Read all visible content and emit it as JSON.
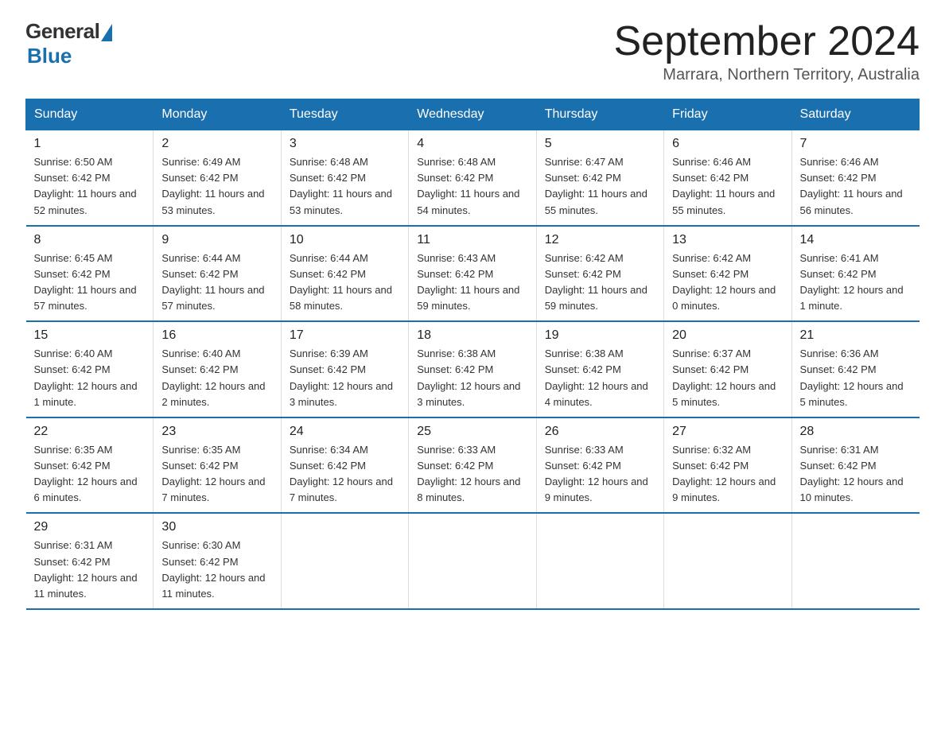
{
  "header": {
    "logo_general": "General",
    "logo_blue": "Blue",
    "title": "September 2024",
    "location": "Marrara, Northern Territory, Australia"
  },
  "columns": [
    "Sunday",
    "Monday",
    "Tuesday",
    "Wednesday",
    "Thursday",
    "Friday",
    "Saturday"
  ],
  "weeks": [
    [
      {
        "day": "1",
        "sunrise": "Sunrise: 6:50 AM",
        "sunset": "Sunset: 6:42 PM",
        "daylight": "Daylight: 11 hours and 52 minutes."
      },
      {
        "day": "2",
        "sunrise": "Sunrise: 6:49 AM",
        "sunset": "Sunset: 6:42 PM",
        "daylight": "Daylight: 11 hours and 53 minutes."
      },
      {
        "day": "3",
        "sunrise": "Sunrise: 6:48 AM",
        "sunset": "Sunset: 6:42 PM",
        "daylight": "Daylight: 11 hours and 53 minutes."
      },
      {
        "day": "4",
        "sunrise": "Sunrise: 6:48 AM",
        "sunset": "Sunset: 6:42 PM",
        "daylight": "Daylight: 11 hours and 54 minutes."
      },
      {
        "day": "5",
        "sunrise": "Sunrise: 6:47 AM",
        "sunset": "Sunset: 6:42 PM",
        "daylight": "Daylight: 11 hours and 55 minutes."
      },
      {
        "day": "6",
        "sunrise": "Sunrise: 6:46 AM",
        "sunset": "Sunset: 6:42 PM",
        "daylight": "Daylight: 11 hours and 55 minutes."
      },
      {
        "day": "7",
        "sunrise": "Sunrise: 6:46 AM",
        "sunset": "Sunset: 6:42 PM",
        "daylight": "Daylight: 11 hours and 56 minutes."
      }
    ],
    [
      {
        "day": "8",
        "sunrise": "Sunrise: 6:45 AM",
        "sunset": "Sunset: 6:42 PM",
        "daylight": "Daylight: 11 hours and 57 minutes."
      },
      {
        "day": "9",
        "sunrise": "Sunrise: 6:44 AM",
        "sunset": "Sunset: 6:42 PM",
        "daylight": "Daylight: 11 hours and 57 minutes."
      },
      {
        "day": "10",
        "sunrise": "Sunrise: 6:44 AM",
        "sunset": "Sunset: 6:42 PM",
        "daylight": "Daylight: 11 hours and 58 minutes."
      },
      {
        "day": "11",
        "sunrise": "Sunrise: 6:43 AM",
        "sunset": "Sunset: 6:42 PM",
        "daylight": "Daylight: 11 hours and 59 minutes."
      },
      {
        "day": "12",
        "sunrise": "Sunrise: 6:42 AM",
        "sunset": "Sunset: 6:42 PM",
        "daylight": "Daylight: 11 hours and 59 minutes."
      },
      {
        "day": "13",
        "sunrise": "Sunrise: 6:42 AM",
        "sunset": "Sunset: 6:42 PM",
        "daylight": "Daylight: 12 hours and 0 minutes."
      },
      {
        "day": "14",
        "sunrise": "Sunrise: 6:41 AM",
        "sunset": "Sunset: 6:42 PM",
        "daylight": "Daylight: 12 hours and 1 minute."
      }
    ],
    [
      {
        "day": "15",
        "sunrise": "Sunrise: 6:40 AM",
        "sunset": "Sunset: 6:42 PM",
        "daylight": "Daylight: 12 hours and 1 minute."
      },
      {
        "day": "16",
        "sunrise": "Sunrise: 6:40 AM",
        "sunset": "Sunset: 6:42 PM",
        "daylight": "Daylight: 12 hours and 2 minutes."
      },
      {
        "day": "17",
        "sunrise": "Sunrise: 6:39 AM",
        "sunset": "Sunset: 6:42 PM",
        "daylight": "Daylight: 12 hours and 3 minutes."
      },
      {
        "day": "18",
        "sunrise": "Sunrise: 6:38 AM",
        "sunset": "Sunset: 6:42 PM",
        "daylight": "Daylight: 12 hours and 3 minutes."
      },
      {
        "day": "19",
        "sunrise": "Sunrise: 6:38 AM",
        "sunset": "Sunset: 6:42 PM",
        "daylight": "Daylight: 12 hours and 4 minutes."
      },
      {
        "day": "20",
        "sunrise": "Sunrise: 6:37 AM",
        "sunset": "Sunset: 6:42 PM",
        "daylight": "Daylight: 12 hours and 5 minutes."
      },
      {
        "day": "21",
        "sunrise": "Sunrise: 6:36 AM",
        "sunset": "Sunset: 6:42 PM",
        "daylight": "Daylight: 12 hours and 5 minutes."
      }
    ],
    [
      {
        "day": "22",
        "sunrise": "Sunrise: 6:35 AM",
        "sunset": "Sunset: 6:42 PM",
        "daylight": "Daylight: 12 hours and 6 minutes."
      },
      {
        "day": "23",
        "sunrise": "Sunrise: 6:35 AM",
        "sunset": "Sunset: 6:42 PM",
        "daylight": "Daylight: 12 hours and 7 minutes."
      },
      {
        "day": "24",
        "sunrise": "Sunrise: 6:34 AM",
        "sunset": "Sunset: 6:42 PM",
        "daylight": "Daylight: 12 hours and 7 minutes."
      },
      {
        "day": "25",
        "sunrise": "Sunrise: 6:33 AM",
        "sunset": "Sunset: 6:42 PM",
        "daylight": "Daylight: 12 hours and 8 minutes."
      },
      {
        "day": "26",
        "sunrise": "Sunrise: 6:33 AM",
        "sunset": "Sunset: 6:42 PM",
        "daylight": "Daylight: 12 hours and 9 minutes."
      },
      {
        "day": "27",
        "sunrise": "Sunrise: 6:32 AM",
        "sunset": "Sunset: 6:42 PM",
        "daylight": "Daylight: 12 hours and 9 minutes."
      },
      {
        "day": "28",
        "sunrise": "Sunrise: 6:31 AM",
        "sunset": "Sunset: 6:42 PM",
        "daylight": "Daylight: 12 hours and 10 minutes."
      }
    ],
    [
      {
        "day": "29",
        "sunrise": "Sunrise: 6:31 AM",
        "sunset": "Sunset: 6:42 PM",
        "daylight": "Daylight: 12 hours and 11 minutes."
      },
      {
        "day": "30",
        "sunrise": "Sunrise: 6:30 AM",
        "sunset": "Sunset: 6:42 PM",
        "daylight": "Daylight: 12 hours and 11 minutes."
      },
      null,
      null,
      null,
      null,
      null
    ]
  ]
}
